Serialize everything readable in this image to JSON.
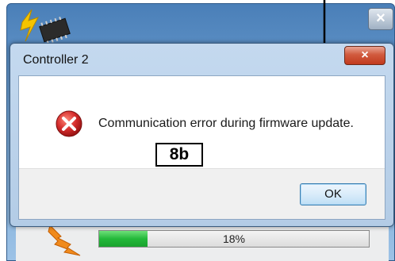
{
  "background_window": {
    "close_label": "×",
    "progress": {
      "value": 0.18,
      "text": "18%"
    },
    "colors": {
      "progress_fill": "#23b83a"
    }
  },
  "dialog": {
    "title": "Controller 2",
    "close_label": "×",
    "message": "Communication error during firmware update.",
    "step_label": "8b",
    "ok_label": "OK",
    "icon": "error-icon",
    "colors": {
      "close_button": "#c13a1e",
      "error_icon": "#d42b2b"
    }
  }
}
